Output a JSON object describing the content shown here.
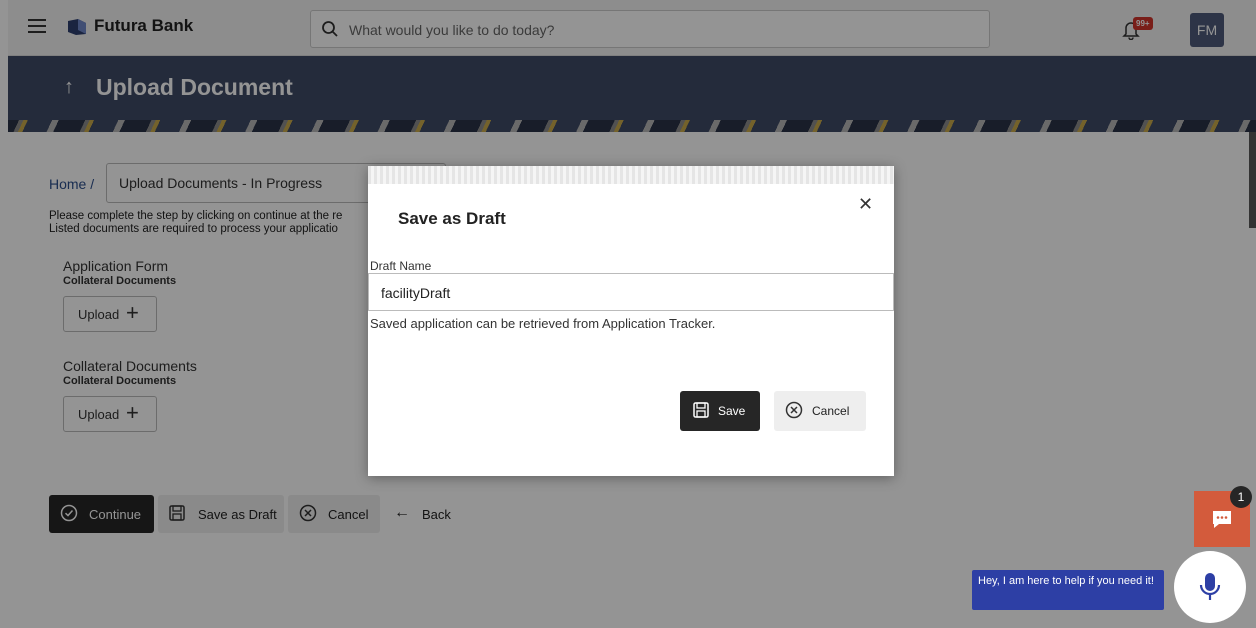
{
  "header": {
    "brand": "Futura Bank",
    "search_placeholder": "What would you like to do today?",
    "notification_badge": "99+",
    "avatar_initials": "FM"
  },
  "page": {
    "title": "Upload Document"
  },
  "breadcrumb": {
    "home": "Home /",
    "current": "Upload Documents - In Progress"
  },
  "instructions": {
    "line1": "Please complete the step by clicking on continue at the re",
    "line2": "Listed documents are required to process your applicatio"
  },
  "documents": [
    {
      "title": "Application Form",
      "subtitle": "Collateral Documents",
      "upload_label": "Upload"
    },
    {
      "title": "Collateral Documents",
      "subtitle": "Collateral Documents",
      "upload_label": "Upload"
    }
  ],
  "actions": {
    "continue": "Continue",
    "save_as_draft": "Save as Draft",
    "cancel": "Cancel",
    "back": "Back"
  },
  "modal": {
    "title": "Save as Draft",
    "field_label": "Draft Name",
    "field_value": "facilityDraft",
    "hint": "Saved application can be retrieved from Application Tracker.",
    "save": "Save",
    "cancel": "Cancel"
  },
  "chat": {
    "unread_count": "1",
    "assistant_hint": "Hey, I am here to help if you need it!"
  },
  "colors": {
    "banner": "#3f4a66",
    "chat_button": "#d35b3c",
    "assistant_bubble": "#2d3fa5",
    "primary_button": "#262626"
  }
}
